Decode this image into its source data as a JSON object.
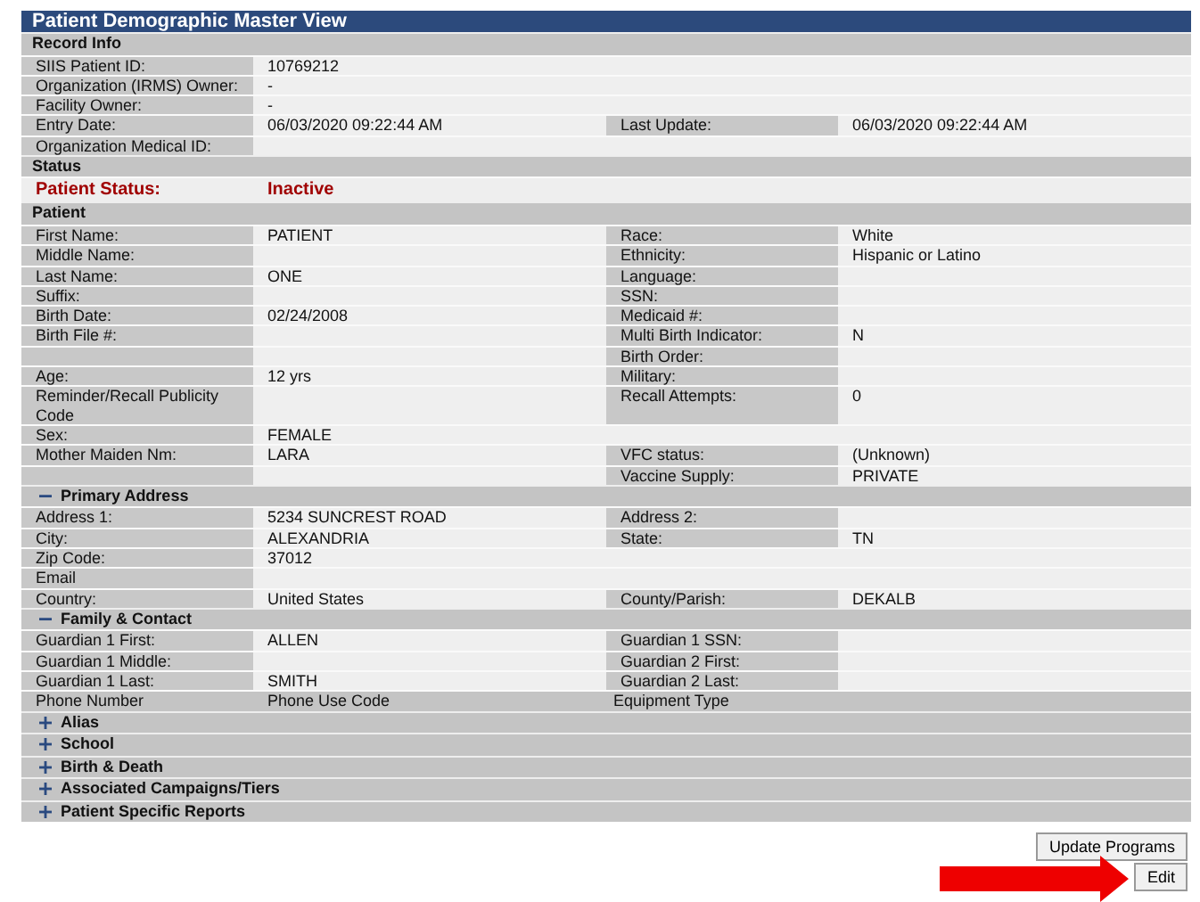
{
  "title": "Patient Demographic Master View",
  "sections": [
    {
      "title": "Record Info",
      "rows": [
        {
          "label": "SIIS Patient ID:",
          "value": "10769212"
        },
        {
          "label": "Organization (IRMS) Owner:",
          "value": "-"
        },
        {
          "label": "Facility Owner:",
          "value": "-"
        },
        {
          "label": "Entry Date:",
          "value": "06/03/2020 09:22:44 AM",
          "label2": "Last Update:",
          "value2": "06/03/2020 09:22:44 AM"
        },
        {
          "label": "Organization Medical ID:"
        }
      ]
    },
    {
      "title": "Status",
      "rows": [
        {
          "kind": "status",
          "label": "Patient Status:",
          "value": "Inactive"
        }
      ]
    },
    {
      "title": "Patient",
      "rows": [
        {
          "label": "First Name:",
          "value": "PATIENT",
          "label2": "Race:",
          "value2": "White"
        },
        {
          "label": "Middle Name:",
          "label2": "Ethnicity:",
          "value2": "Hispanic or Latino"
        },
        {
          "label": "Last Name:",
          "value": "ONE",
          "label2": "Language:"
        },
        {
          "label": "Suffix:",
          "label2": "SSN:"
        },
        {
          "label": "Birth Date:",
          "value": "02/24/2008",
          "label2": "Medicaid #:"
        },
        {
          "label": "Birth File #:",
          "label2": "Multi Birth Indicator:",
          "value2": "N"
        },
        {
          "label2": "Birth Order:"
        },
        {
          "label": "Age:",
          "value": "12 yrs",
          "label2": "Military:"
        },
        {
          "label": "Reminder/Recall Publicity Code",
          "label2": "Recall Attempts:",
          "value2": "0"
        },
        {
          "label": "Sex:",
          "value": "FEMALE"
        },
        {
          "label": "Mother Maiden Nm:",
          "value": "LARA",
          "label2": "VFC status:",
          "value2": "(Unknown)"
        },
        {
          "label2": "Vaccine Supply:",
          "value2": "PRIVATE"
        }
      ]
    },
    {
      "title": "Primary Address",
      "expanded": true,
      "rows": [
        {
          "label": "Address 1:",
          "value": "5234 SUNCREST ROAD",
          "label2": "Address 2:"
        },
        {
          "label": "City:",
          "value": "ALEXANDRIA",
          "label2": "State:",
          "value2": "TN"
        },
        {
          "label": "Zip Code:",
          "value": "37012"
        },
        {
          "label": "Email"
        },
        {
          "label": "Country:",
          "value": "United States",
          "label2": "County/Parish:",
          "value2": "DEKALB"
        }
      ]
    },
    {
      "title": "Family & Contact",
      "expanded": true,
      "rows": [
        {
          "label": "Guardian 1 First:",
          "value": "ALLEN",
          "label2": "Guardian 1 SSN:"
        },
        {
          "label": "Guardian 1 Middle:",
          "label2": "Guardian 2 First:"
        },
        {
          "label": "Guardian 1 Last:",
          "value": "SMITH",
          "label2": "Guardian 2 Last:"
        },
        {
          "kind": "heading",
          "label": "Phone Number",
          "value": "Phone Use Code",
          "label2": "Equipment Type"
        }
      ]
    },
    {
      "title": "Alias",
      "expanded": false
    },
    {
      "title": "School",
      "expanded": false
    },
    {
      "title": "Birth & Death",
      "expanded": false
    },
    {
      "title": "Associated Campaigns/Tiers",
      "expanded": false
    },
    {
      "title": "Patient Specific Reports",
      "expanded": false
    }
  ],
  "buttons": [
    "Update Programs",
    "Edit"
  ]
}
